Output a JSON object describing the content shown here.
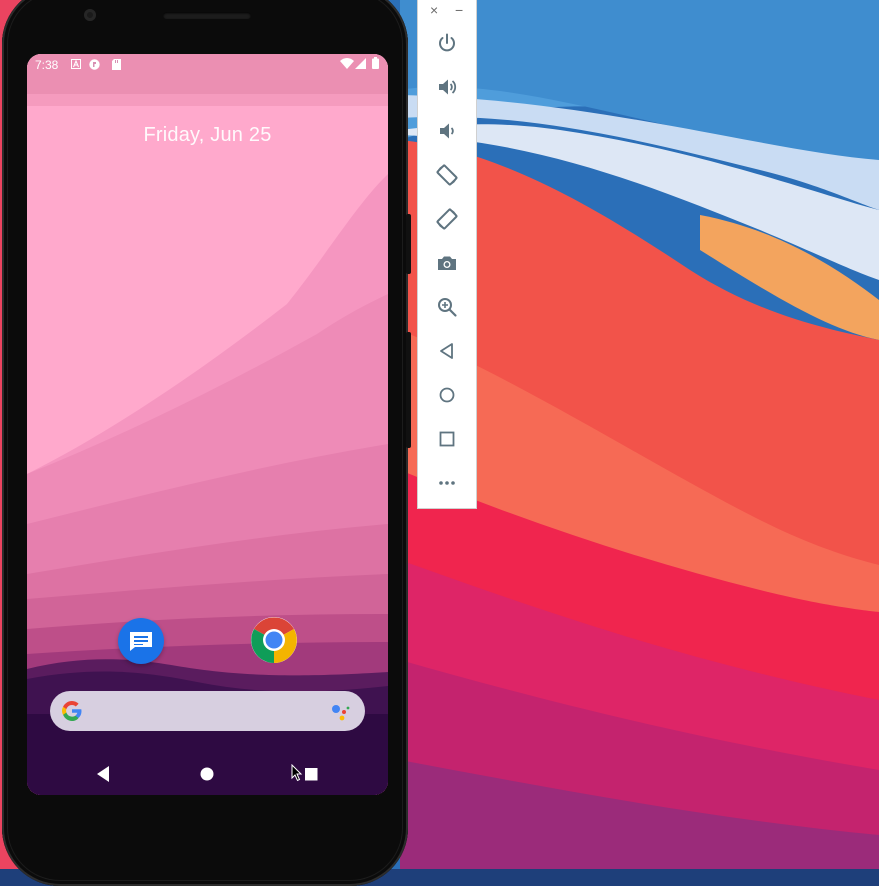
{
  "desktop": {
    "wallpaper": "macOS Big Sur"
  },
  "phone": {
    "status_bar": {
      "time": "7:38",
      "left_icons": [
        "a11y-icon",
        "settings-notification-icon",
        "sd-card-icon"
      ],
      "right_icons": [
        "wifi-icon",
        "signal-icon",
        "battery-icon"
      ]
    },
    "home": {
      "date": "Friday, Jun 25",
      "dock_apps": [
        {
          "name": "Messages",
          "icon": "messages-icon"
        },
        {
          "name": "Chrome",
          "icon": "chrome-icon"
        }
      ],
      "search_bar": {
        "left_icon": "google-g-icon",
        "right_icon": "google-assistant-icon"
      }
    },
    "nav_bar": {
      "buttons": [
        "back",
        "home",
        "recents"
      ]
    }
  },
  "emulator_toolbar": {
    "window_controls": {
      "close": "×",
      "minimize": "−"
    },
    "buttons": [
      {
        "id": "power",
        "icon": "power-icon"
      },
      {
        "id": "volume-up",
        "icon": "volume-up-icon"
      },
      {
        "id": "volume-down",
        "icon": "volume-down-icon"
      },
      {
        "id": "rotate-left",
        "icon": "rotate-left-icon"
      },
      {
        "id": "rotate-right",
        "icon": "rotate-right-icon"
      },
      {
        "id": "screenshot",
        "icon": "camera-icon"
      },
      {
        "id": "zoom",
        "icon": "zoom-icon"
      },
      {
        "id": "back",
        "icon": "back-icon"
      },
      {
        "id": "home",
        "icon": "home-icon"
      },
      {
        "id": "overview",
        "icon": "overview-icon"
      },
      {
        "id": "more",
        "icon": "more-icon"
      }
    ]
  },
  "colors": {
    "phone_wallpaper_top": "#ffa9cc",
    "phone_wallpaper_bottom": "#2e0a42",
    "toolbar_icon": "#5f7480",
    "messages_blue": "#1a73e8"
  }
}
